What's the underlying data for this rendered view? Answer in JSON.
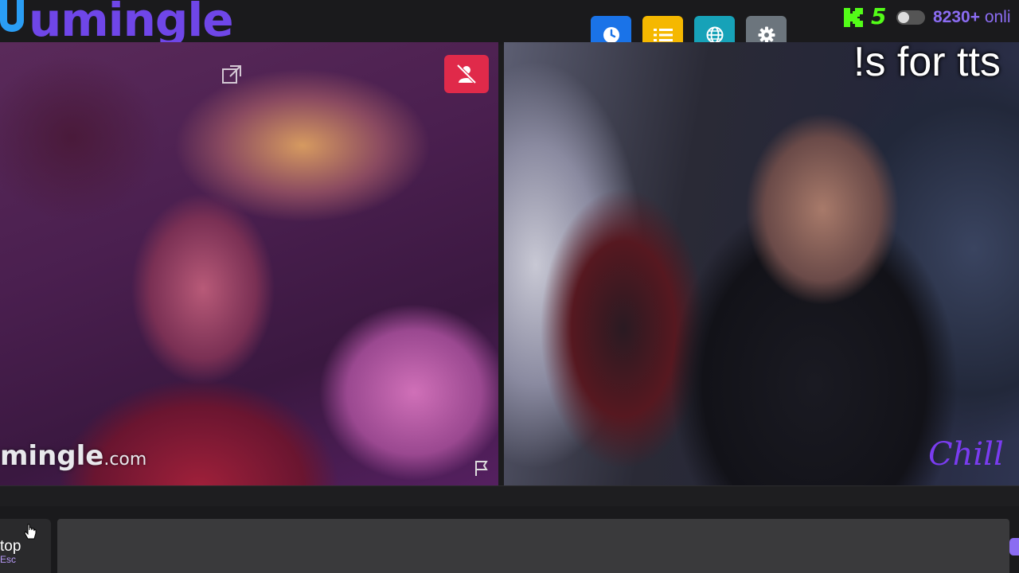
{
  "app": {
    "logo_text": "umingle",
    "kick_count": "5",
    "online_count": "8230+",
    "online_suffix": "onli"
  },
  "toolbar": {
    "buttons": [
      {
        "icon": "clock-icon",
        "color": "#1a73e8"
      },
      {
        "icon": "list-icon",
        "color": "#f5b800"
      },
      {
        "icon": "globe-icon",
        "color": "#17a2b8"
      },
      {
        "icon": "gear-icon",
        "color": "#6c757d"
      }
    ]
  },
  "overlay": {
    "tts_text": "!s for tts",
    "brand_overlay": "Chill"
  },
  "video_left": {
    "watermark_main": "mingle",
    "watermark_domain": ".com"
  },
  "controls": {
    "stop_label": "top",
    "esc_label": "Esc",
    "chat_placeholder": ""
  },
  "colors": {
    "brand_purple": "#6f46e8",
    "cam_off_red": "#e02a4a",
    "kick_green": "#53fc18"
  }
}
